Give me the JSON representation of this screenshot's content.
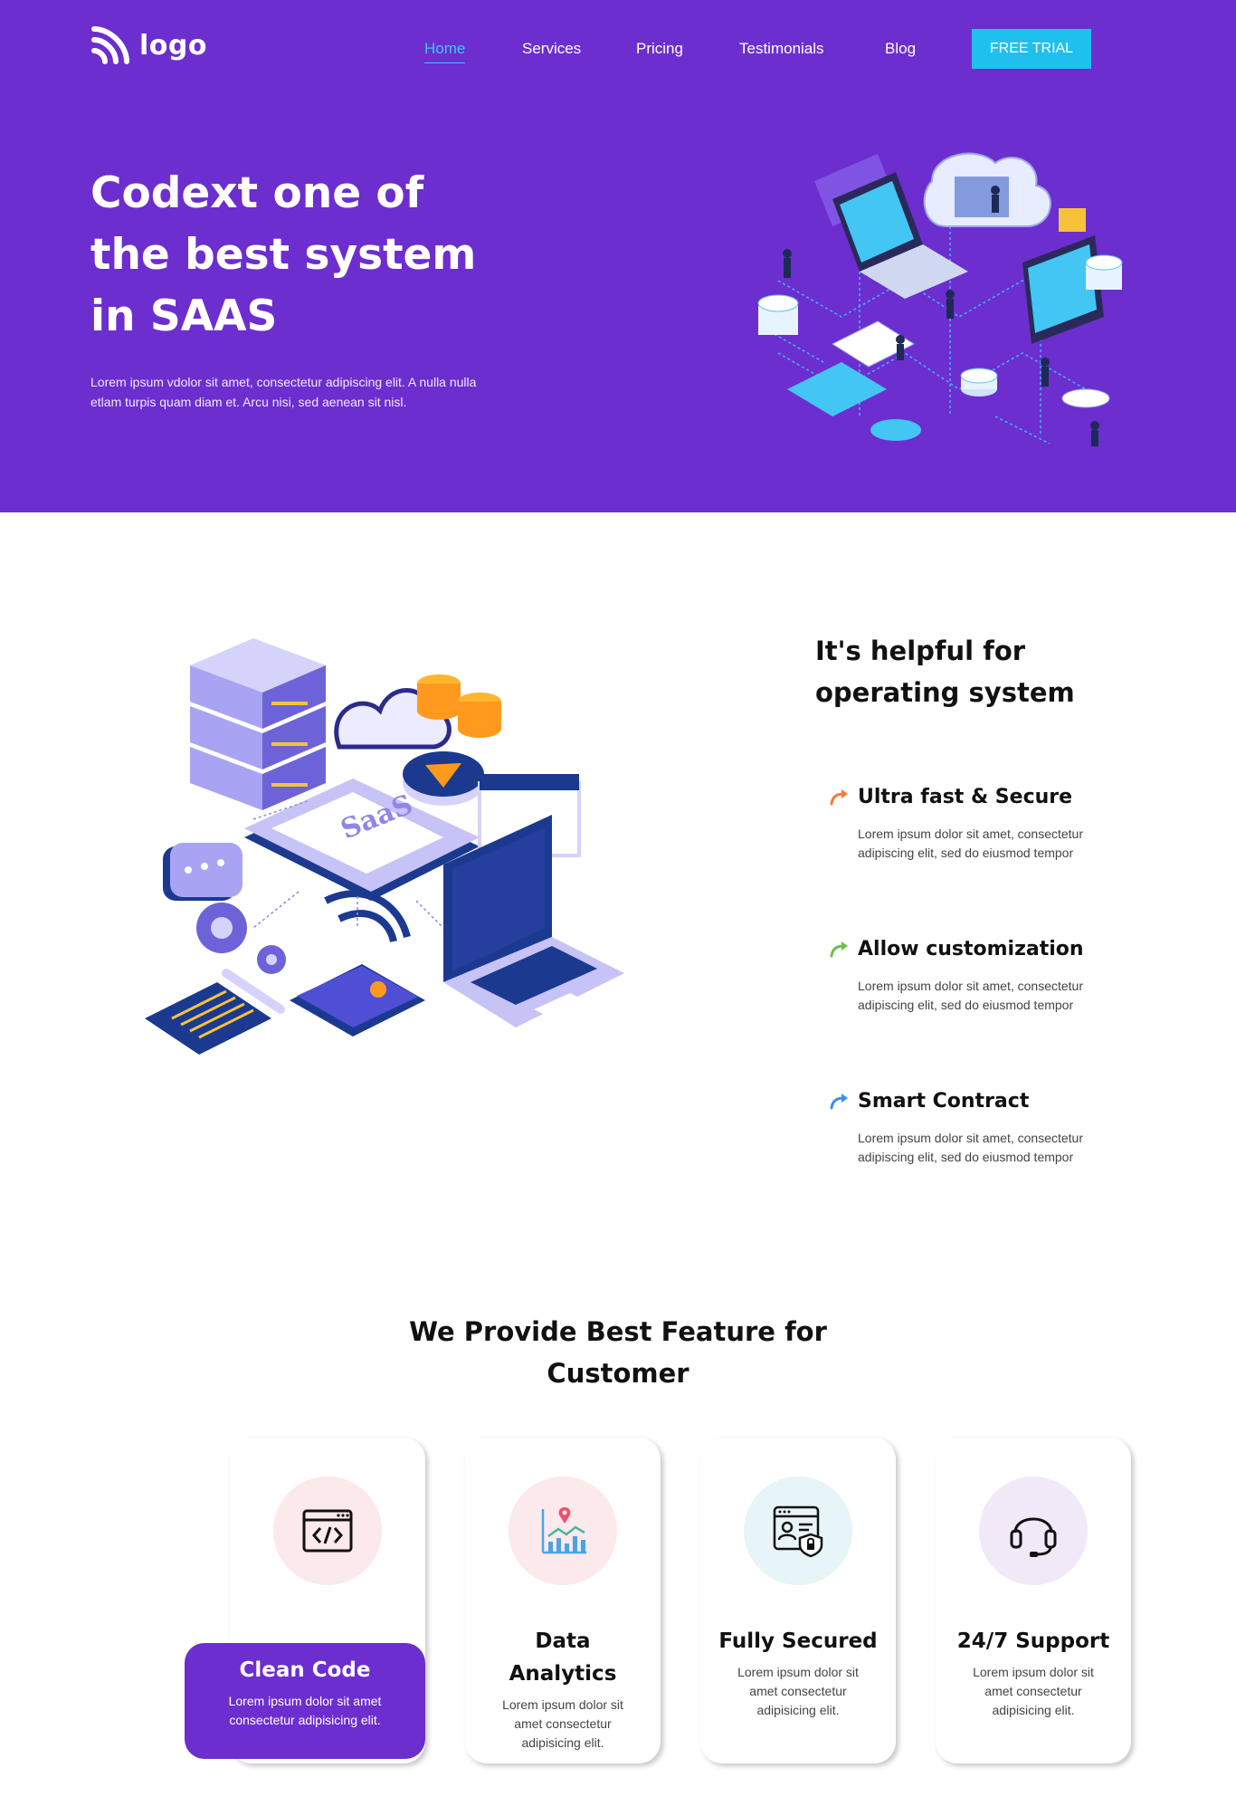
{
  "header": {
    "logo_text": "logo",
    "nav": [
      "Home",
      "Services",
      "Pricing",
      "Testimonials",
      "Blog"
    ],
    "active_nav": "Home",
    "cta_label": "FREE TRIAL"
  },
  "hero": {
    "title": "Codext one of the best system in SAAS",
    "description": "Lorem ipsum vdolor sit amet, consectetur adipiscing elit. A nulla nulla etlam turpis quam diam et. Arcu nisi, sed aenean sit nisl."
  },
  "helpful": {
    "illustration_label": "SaaS",
    "title": "It's helpful for operating system",
    "items": [
      {
        "title": "Ultra fast & Secure",
        "desc": "Lorem ipsum dolor sit amet, consectetur adipiscing elit, sed do eiusmod tempor",
        "arrow_color": "#f47b3b"
      },
      {
        "title": "Allow customization",
        "desc": "Lorem ipsum dolor sit amet, consectetur adipiscing elit, sed do eiusmod tempor",
        "arrow_color": "#6cc04a"
      },
      {
        "title": "Smart Contract",
        "desc": "Lorem ipsum dolor sit amet, consectetur adipiscing elit, sed do eiusmod tempor",
        "arrow_color": "#3b8df4"
      }
    ]
  },
  "features": {
    "title": "We Provide Best Feature for Customer",
    "cards": [
      {
        "title": "Clean Code",
        "desc": "Lorem ipsum dolor sit amet consectetur adipisicing elit.",
        "icon": "code-window-icon",
        "active": true
      },
      {
        "title": "Data Analytics",
        "desc": "Lorem ipsum dolor sit amet consectetur adipisicing elit.",
        "icon": "analytics-chart-icon",
        "active": false
      },
      {
        "title": "Fully Secured",
        "desc": "Lorem ipsum dolor sit amet consectetur adipisicing elit.",
        "icon": "security-shield-icon",
        "active": false
      },
      {
        "title": "24/7 Support",
        "desc": "Lorem ipsum dolor sit amet consectetur adipisicing elit.",
        "icon": "headset-icon",
        "active": false
      }
    ]
  },
  "colors": {
    "brand_purple": "#6c2ecf",
    "accent_cyan": "#1fc0ee"
  }
}
